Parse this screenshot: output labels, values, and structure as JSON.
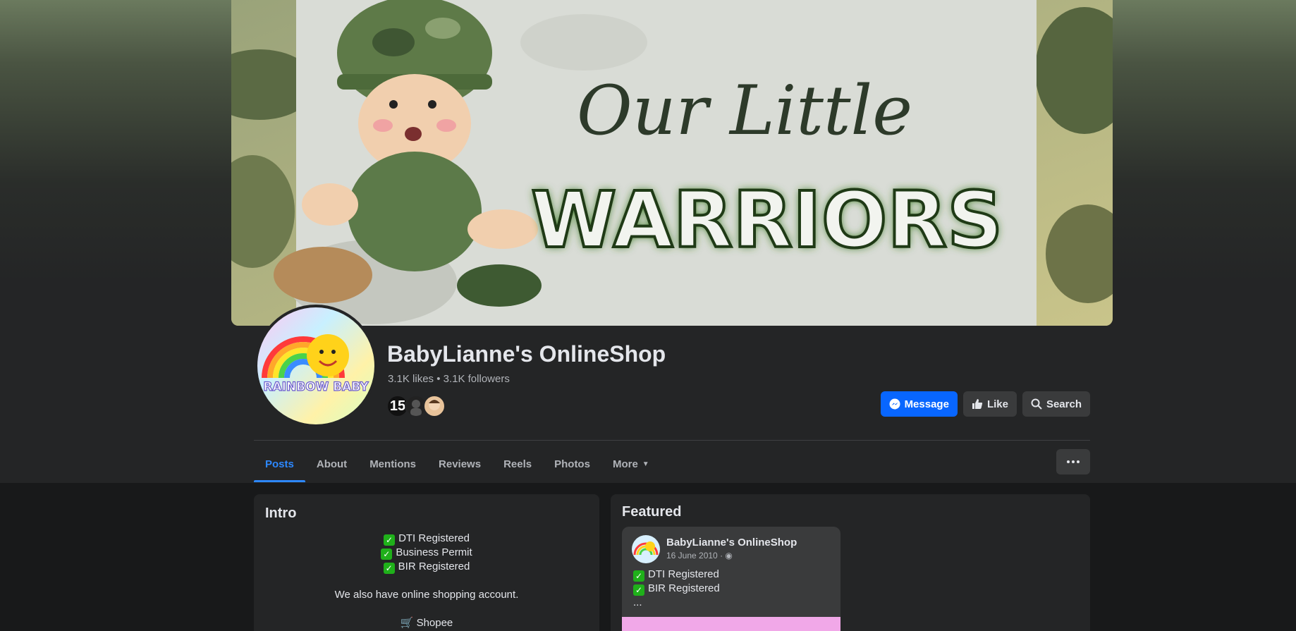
{
  "cover": {
    "text_line1": "Our Little",
    "text_line2": "WARRIORS"
  },
  "profile": {
    "logo_text": "RAINBOW BABY"
  },
  "page": {
    "name": "BabyLianne's OnlineShop",
    "stats": "3.1K likes • 3.1K followers",
    "friend_badge": "15"
  },
  "actions": {
    "message_label": "Message",
    "like_label": "Like",
    "search_label": "Search"
  },
  "tabs": [
    {
      "label": "Posts",
      "active": true
    },
    {
      "label": "About"
    },
    {
      "label": "Mentions"
    },
    {
      "label": "Reviews"
    },
    {
      "label": "Reels"
    },
    {
      "label": "Photos"
    },
    {
      "label": "More"
    }
  ],
  "intro": {
    "title": "Intro",
    "line1": "DTI Registered",
    "line2": "Business Permit",
    "line3": "BIR Registered",
    "line4": "We also have online shopping account.",
    "line5": "Shopee"
  },
  "featured": {
    "title": "Featured",
    "post": {
      "author": "BabyLianne's OnlineShop",
      "date": "16 June 2010 ·",
      "line1": "DTI Registered",
      "line2": "BIR Registered",
      "line3": "..."
    }
  },
  "colors": {
    "accent": "#2d88ff",
    "primary_button": "#0866ff",
    "background": "#18191a",
    "card": "#242526"
  }
}
